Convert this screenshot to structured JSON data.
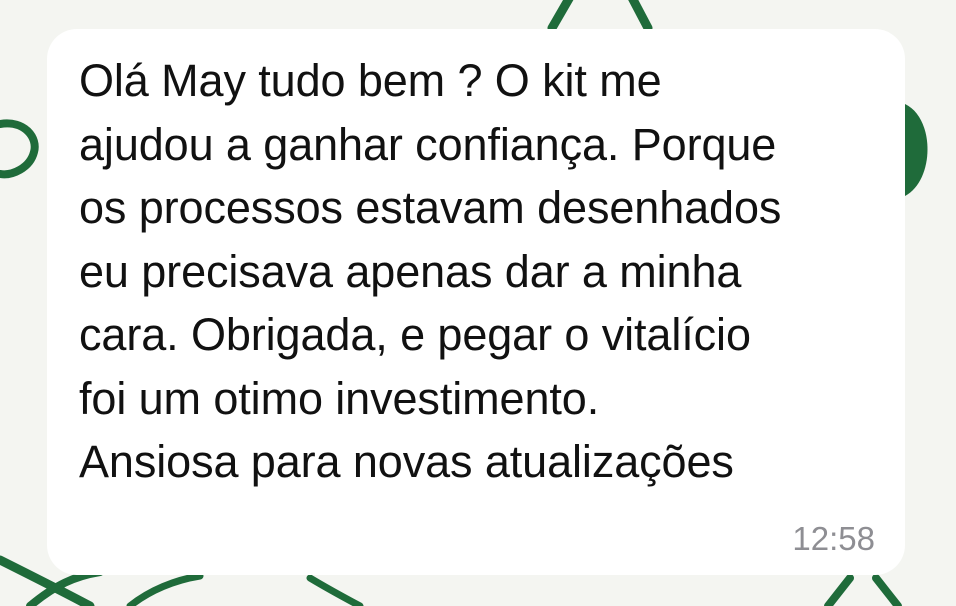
{
  "chat": {
    "message": {
      "lines": [
        "Olá May tudo bem ? O kit me",
        "ajudou a ganhar confiança. Porque",
        "os processos estavam desenhados",
        "eu precisava apenas dar a minha",
        "cara. Obrigada, e pegar o vitalício",
        "foi um otimo investimento.",
        "Ansiosa para novas atualizações"
      ],
      "time": "12:58"
    }
  },
  "colors": {
    "wallpaper": "#f4f5f1",
    "wallpaper_pattern": "#1f6b3a",
    "bubble": "#ffffff",
    "text": "#111111",
    "timestamp": "#8e8e93"
  }
}
